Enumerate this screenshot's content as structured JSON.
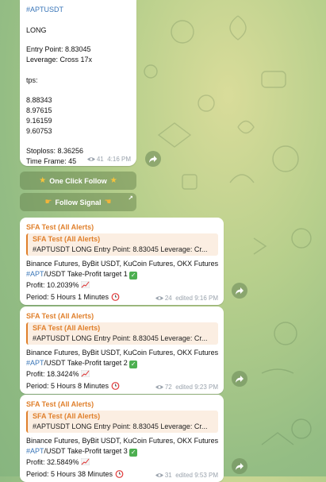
{
  "first_message": {
    "hashtag": "#APTUSDT",
    "direction": "LONG",
    "entry": "Entry Point: 8.83045",
    "leverage": "Leverage: Cross 17x",
    "tps_label": "tps:",
    "tps": [
      "8.88343",
      "8.97615",
      "9.16159",
      "9.60753"
    ],
    "stoploss": "Stoploss:  8.36256",
    "timeframe": "Time Frame: 45",
    "views": "41",
    "time": "4:16 PM"
  },
  "buttons": {
    "one_click": "One Click Follow",
    "follow_signal": "Follow Signal"
  },
  "alerts": [
    {
      "sender": "SFA Test (All Alerts)",
      "reply_sender": "SFA Test (All Alerts)",
      "reply_text": "#APTUSDT   LONG    Entry Point: 8.83045 Leverage: Cr...",
      "exchanges": "Binance Futures, ByBit USDT, KuCoin Futures, OKX Futures",
      "tp_tag": "#APT",
      "tp_text": "/USDT Take-Profit target 1",
      "profit": "Profit: 10.2039%",
      "period": "Period: 5 Hours 1 Minutes",
      "views": "24",
      "time": "edited 9:16 PM"
    },
    {
      "sender": "SFA Test (All Alerts)",
      "reply_sender": "SFA Test (All Alerts)",
      "reply_text": "#APTUSDT   LONG    Entry Point: 8.83045 Leverage: Cr...",
      "exchanges": "Binance Futures, ByBit USDT, KuCoin Futures, OKX Futures",
      "tp_tag": "#APT",
      "tp_text": "/USDT Take-Profit target 2",
      "profit": "Profit: 18.3424%",
      "period": "Period: 5 Hours 8 Minutes",
      "views": "72",
      "time": "edited 9:23 PM"
    },
    {
      "sender": "SFA Test (All Alerts)",
      "reply_sender": "SFA Test (All Alerts)",
      "reply_text": "#APTUSDT   LONG    Entry Point: 8.83045 Leverage: Cr...",
      "exchanges": "Binance Futures, ByBit USDT, KuCoin Futures, OKX Futures",
      "tp_tag": "#APT",
      "tp_text": "/USDT Take-Profit target 3",
      "profit": "Profit: 32.5849%",
      "period": "Period: 5 Hours 38 Minutes",
      "views": "31",
      "time": "edited 9:53 PM"
    }
  ],
  "colors": {
    "accent": "#e0802c",
    "link": "#3a76b8",
    "check": "#4caf50"
  }
}
